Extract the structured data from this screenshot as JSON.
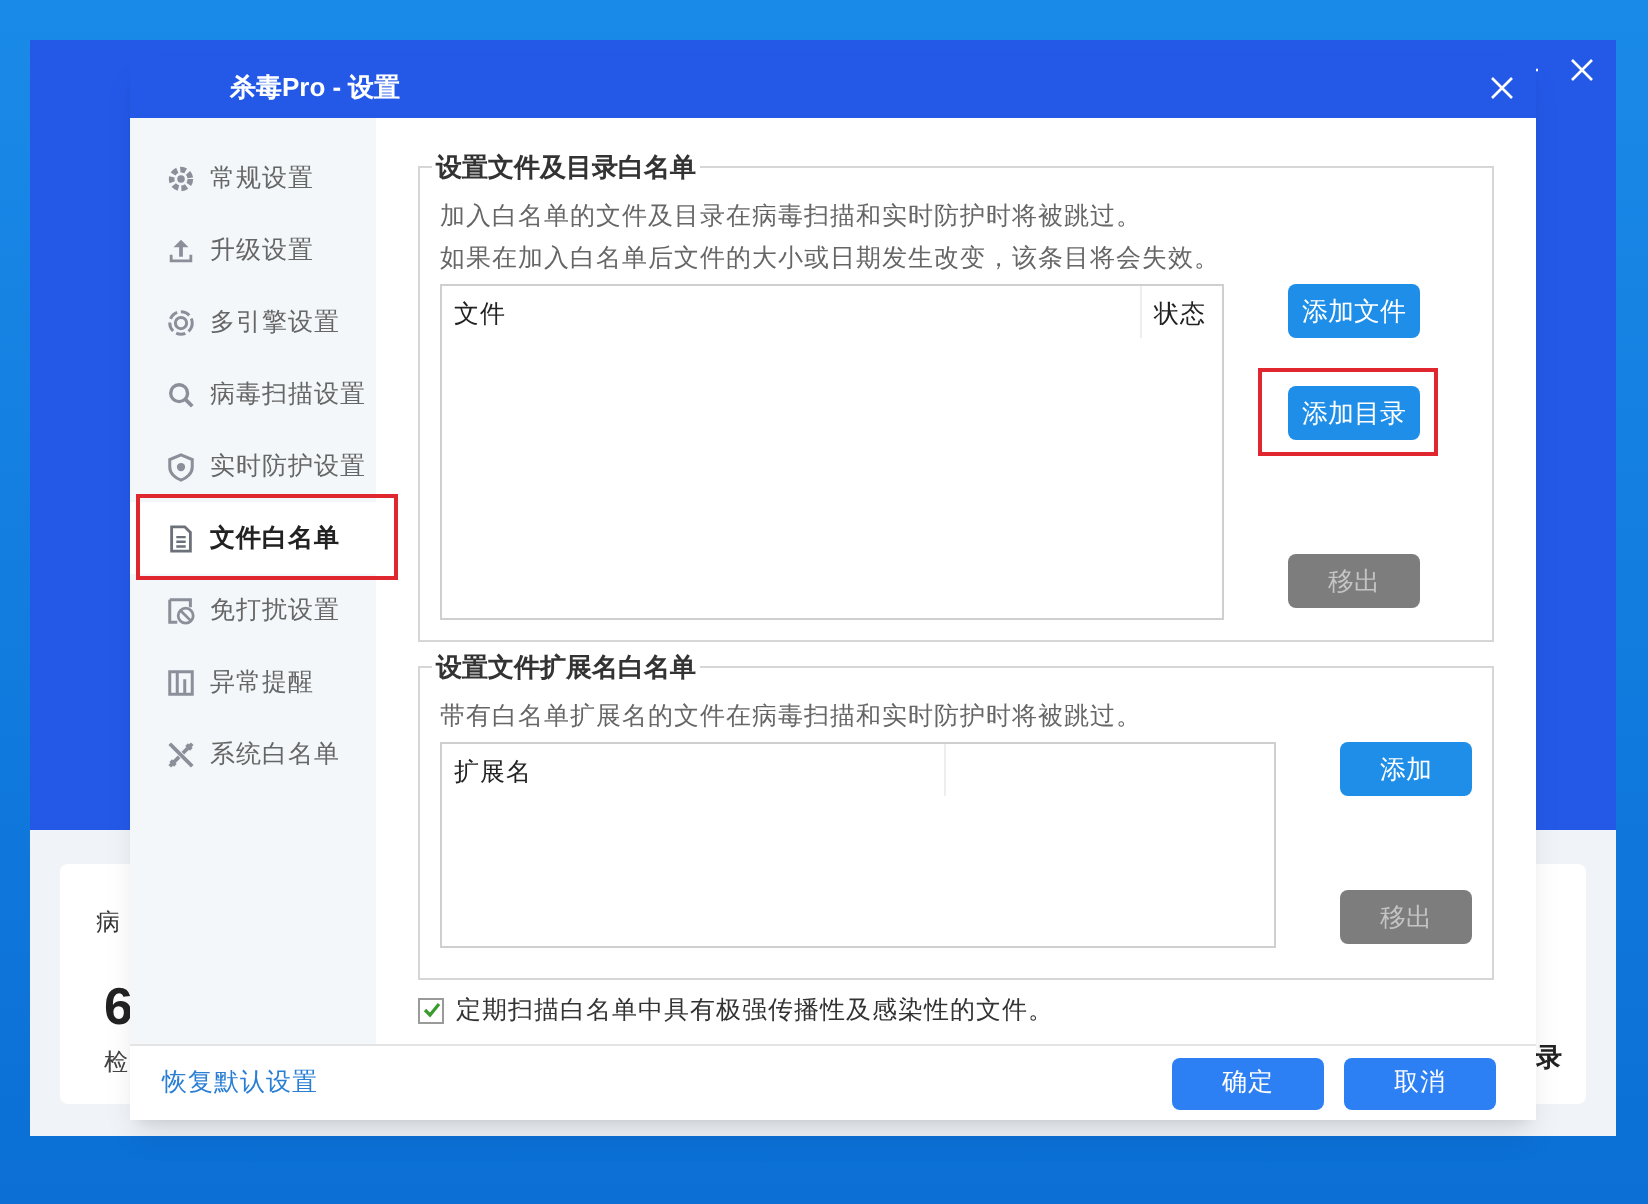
{
  "background_window": {
    "card_texts": [
      "病",
      "6",
      "检",
      "录"
    ]
  },
  "dialog": {
    "title": "杀毒Pro - 设置",
    "sidebar": {
      "items": [
        {
          "label": "常规设置",
          "selected": false,
          "annotated": false
        },
        {
          "label": "升级设置",
          "selected": false,
          "annotated": false
        },
        {
          "label": "多引擎设置",
          "selected": false,
          "annotated": false
        },
        {
          "label": "病毒扫描设置",
          "selected": false,
          "annotated": false
        },
        {
          "label": "实时防护设置",
          "selected": false,
          "annotated": false
        },
        {
          "label": "文件白名单",
          "selected": true,
          "annotated": true
        },
        {
          "label": "免打扰设置",
          "selected": false,
          "annotated": false
        },
        {
          "label": "异常提醒",
          "selected": false,
          "annotated": false
        },
        {
          "label": "系统白名单",
          "selected": false,
          "annotated": false
        }
      ]
    },
    "sections": [
      {
        "title": "设置文件及目录白名单",
        "notes": [
          "加入白名单的文件及目录在病毒扫描和实时防护时将被跳过。",
          "如果在加入白名单后文件的大小或日期发生改变，该条目将会失效。"
        ],
        "columns": [
          "文件",
          "状态"
        ],
        "buttons": [
          {
            "label": "添加文件",
            "disabled": false,
            "annotated": false
          },
          {
            "label": "添加目录",
            "disabled": false,
            "annotated": true
          },
          {
            "label": "移出",
            "disabled": true,
            "annotated": false
          }
        ]
      },
      {
        "title": "设置文件扩展名白名单",
        "notes": [
          "带有白名单扩展名的文件在病毒扫描和实时防护时将被跳过。"
        ],
        "columns": [
          "扩展名"
        ],
        "buttons": [
          {
            "label": "添加",
            "disabled": false,
            "annotated": false
          },
          {
            "label": "移出",
            "disabled": true,
            "annotated": false
          }
        ]
      }
    ],
    "checkbox": {
      "label": "定期扫描白名单中具有极强传播性及感染性的文件。",
      "checked": true
    },
    "restore_link": "恢复默认设置",
    "buttons": [
      "确定",
      "取消"
    ]
  }
}
